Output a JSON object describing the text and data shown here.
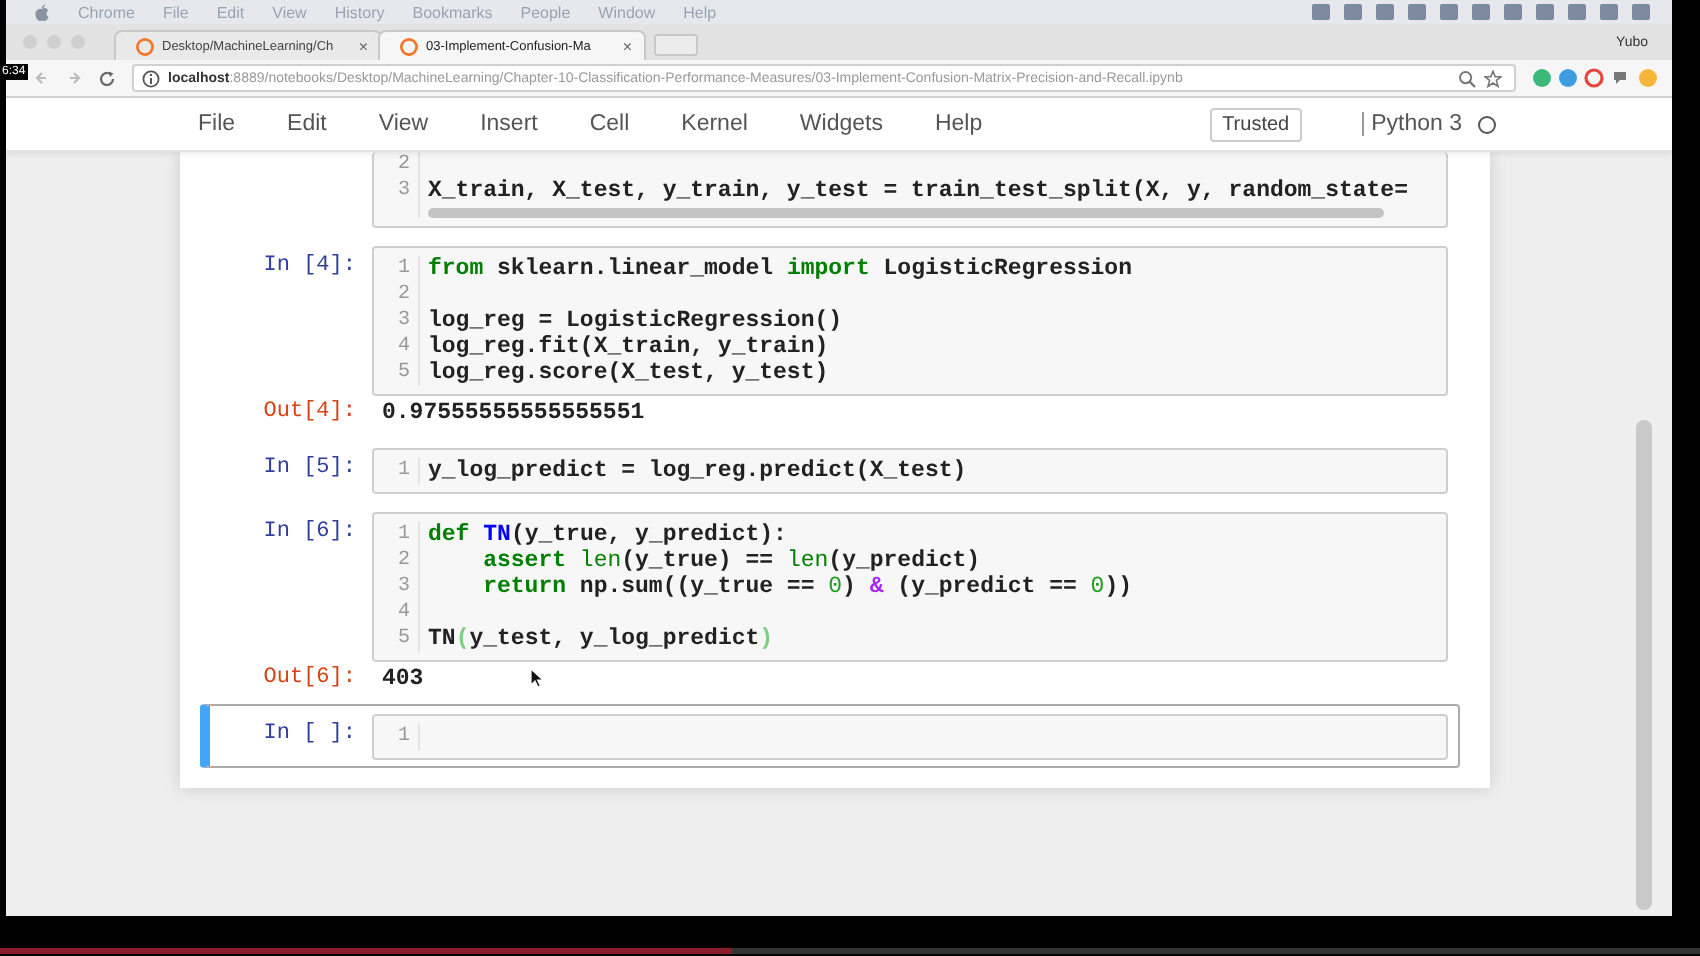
{
  "video_overlay": {
    "time": "6:34",
    "progress": {
      "level": 0.43
    }
  },
  "mac_menu": {
    "items": [
      "Chrome",
      "File",
      "Edit",
      "View",
      "History",
      "Bookmarks",
      "People",
      "Window",
      "Help"
    ]
  },
  "profile_name": "Yubo",
  "tabs": [
    {
      "title": "Desktop/MachineLearning/Ch",
      "close": "×",
      "selected": false
    },
    {
      "title": "03-Implement-Confusion-Ma",
      "close": "×",
      "selected": true
    }
  ],
  "address_bar": {
    "url": "**localhost**:8889/notebooks/Desktop/MachineLearning/Chapter-10-Classification-Performance-Measures/03-Implement-Confusion-Matrix-Precision-and-Recall.ipynb"
  },
  "jupyter_menu": {
    "items": [
      "File",
      "Edit",
      "View",
      "Insert",
      "Cell",
      "Kernel",
      "Widgets",
      "Help"
    ],
    "trusted": "Trusted",
    "kernel": "Python 3",
    "kernel_busy": false
  },
  "cells": [
    {
      "kind": "code",
      "selected": false,
      "horizontal_scrollbar": true,
      "lines": [
        {
          "number": "2"
        },
        {
          "number": "3",
          "tokens": [
            {
              "kind": "plain",
              "text": "X_train, X_test, y_train, y_test = train_test_split(X, y, random_state="
            }
          ]
        }
      ]
    },
    {
      "kind": "code",
      "prompt": "In [4]:",
      "selected": false,
      "lines": [
        {
          "number": "1",
          "tokens": [
            {
              "kind": "keyword",
              "text": "from"
            },
            {
              "kind": "plain",
              "text": " sklearn.linear_model "
            },
            {
              "kind": "keyword",
              "text": "import"
            },
            {
              "kind": "plain",
              "text": " LogisticRegression"
            }
          ]
        },
        {
          "number": "2"
        },
        {
          "number": "3",
          "tokens": [
            {
              "kind": "plain",
              "text": "log_reg = LogisticRegression()"
            }
          ]
        },
        {
          "number": "4",
          "tokens": [
            {
              "kind": "plain",
              "text": "log_reg.fit(X_train, y_train)"
            }
          ]
        },
        {
          "number": "5",
          "tokens": [
            {
              "kind": "plain",
              "text": "log_reg.score(X_test, y_test)"
            }
          ]
        }
      ],
      "output": {
        "prompt": "Out[4]:",
        "text": "0.97555555555555551"
      }
    },
    {
      "kind": "code",
      "prompt": "In [5]:",
      "selected": false,
      "lines": [
        {
          "number": "1",
          "tokens": [
            {
              "kind": "plain",
              "text": "y_log_predict = log_reg.predict(X_test)"
            }
          ]
        }
      ]
    },
    {
      "kind": "code",
      "prompt": "In [6]:",
      "selected": false,
      "lines": [
        {
          "number": "1",
          "tokens": [
            {
              "kind": "keyword",
              "text": "def"
            },
            {
              "kind": "def_name",
              "text": " TN"
            },
            {
              "kind": "plain",
              "text": "(y_true, y_predict):"
            }
          ]
        },
        {
          "number": "2",
          "tokens": [
            {
              "kind": "keyword",
              "text": "    assert"
            },
            {
              "kind": "builtin",
              "text": " len"
            },
            {
              "kind": "plain",
              "text": "(y_true) == "
            },
            {
              "kind": "builtin",
              "text": "len"
            },
            {
              "kind": "plain",
              "text": "(y_predict)"
            }
          ]
        },
        {
          "number": "3",
          "tokens": [
            {
              "kind": "keyword",
              "text": "    return"
            },
            {
              "kind": "plain",
              "text": " np.sum((y_true == "
            },
            {
              "kind": "number",
              "text": "0"
            },
            {
              "kind": "plain",
              "text": ") "
            },
            {
              "kind": "operator",
              "text": "&"
            },
            {
              "kind": "plain",
              "text": " (y_predict == "
            },
            {
              "kind": "number",
              "text": "0"
            },
            {
              "kind": "plain",
              "text": "))"
            }
          ]
        },
        {
          "number": "4"
        },
        {
          "number": "5",
          "tokens": [
            {
              "kind": "plain",
              "text": "TN"
            },
            {
              "kind": "bracket_match",
              "text": "("
            },
            {
              "kind": "plain",
              "text": "y_test, y_log_predict"
            },
            {
              "kind": "bracket_match",
              "text": ")"
            }
          ]
        }
      ],
      "output": {
        "prompt": "Out[6]:",
        "text": "403"
      }
    },
    {
      "kind": "code",
      "prompt": "In [ ]:",
      "selected": true,
      "lines": [
        {
          "number": "1"
        }
      ]
    }
  ]
}
